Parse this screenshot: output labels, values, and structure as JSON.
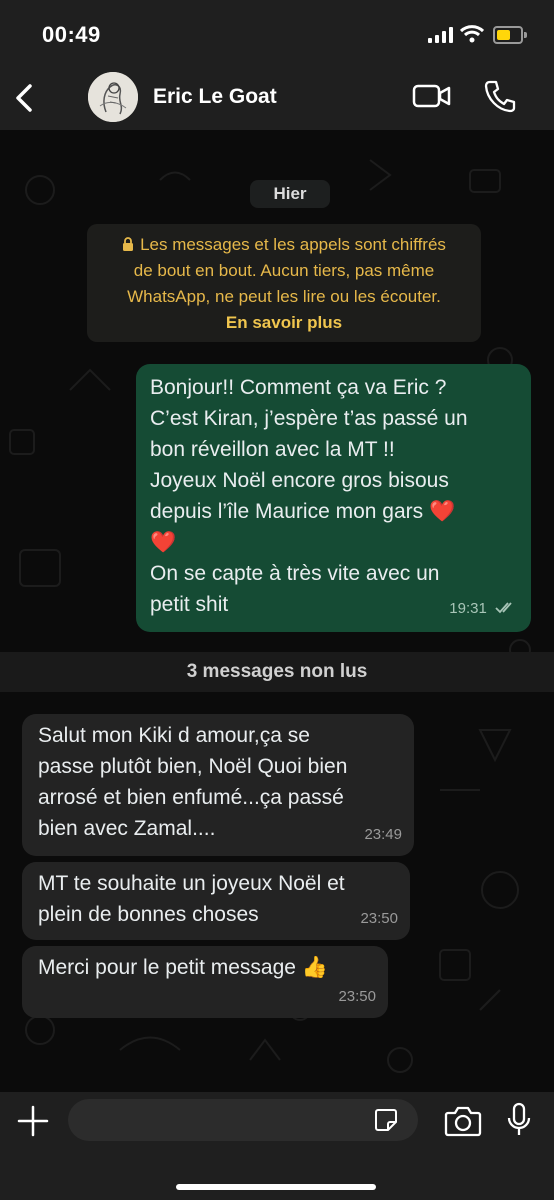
{
  "status": {
    "time": "00:49"
  },
  "header": {
    "contact_name": "Eric Le Goat"
  },
  "chat": {
    "date_label": "Hier",
    "encryption": {
      "lines": [
        "Les messages et les appels sont chiffrés",
        "de bout en bout. Aucun tiers, pas même",
        "WhatsApp, ne peut les lire ou les écouter."
      ],
      "link": "En savoir plus"
    },
    "outgoing": {
      "lines": [
        "Bonjour!! Comment ça va Eric ?",
        "C’est Kiran, j’espère t’as passé un",
        "bon réveillon avec la MT !!",
        "Joyeux Noël  encore gros bisous",
        "depuis l’île Maurice mon gars ❤️",
        "❤️",
        "On se capte à très vite avec un",
        "petit shit"
      ],
      "time": "19:31"
    },
    "unread_label": "3 messages non lus",
    "incoming": [
      {
        "lines": [
          "Salut mon Kiki d amour,ça se",
          "passe plutôt bien, Noël Quoi bien",
          "arrosé et bien enfumé...ça passé",
          "bien avec Zamal...."
        ],
        "time": "23:49"
      },
      {
        "lines": [
          "MT te souhaite un joyeux Noël et",
          "plein de bonnes choses"
        ],
        "time": "23:50"
      },
      {
        "lines": [
          "Merci pour le petit message 👍"
        ],
        "time": "23:50"
      }
    ]
  },
  "colors": {
    "outgoing_bubble": "#154b34",
    "incoming_bubble": "#232323",
    "encryption_text": "#e6b84a"
  }
}
